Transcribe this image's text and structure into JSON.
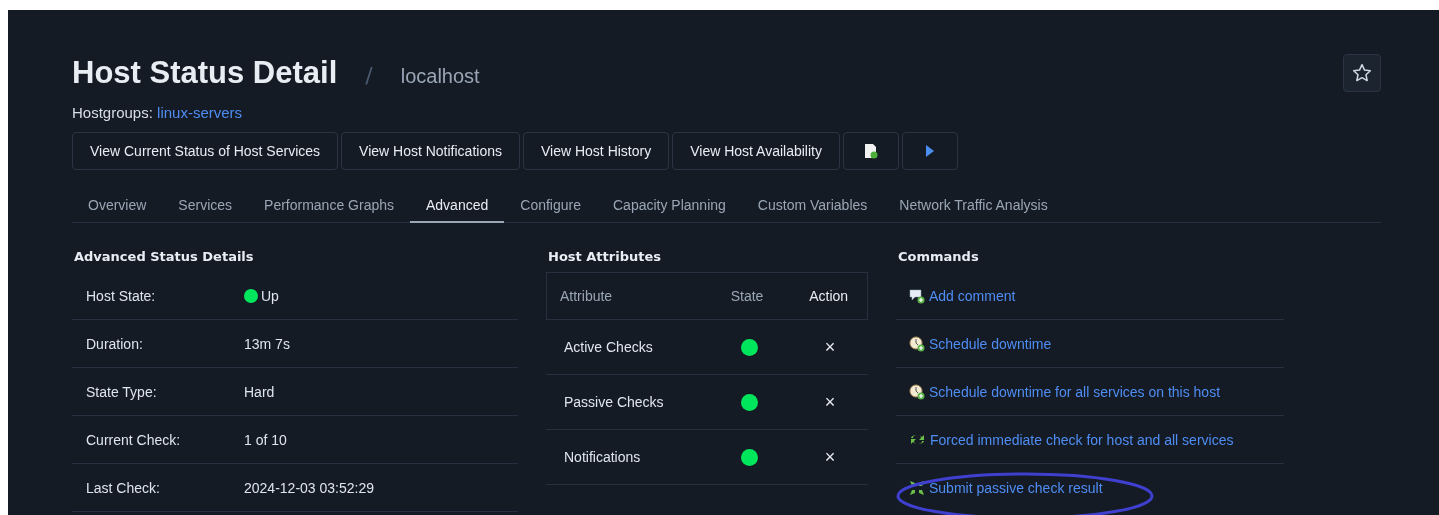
{
  "header": {
    "title": "Host Status Detail",
    "separator": "/",
    "host": "localhost",
    "hostgroups_label": "Hostgroups:",
    "hostgroup": "linux-servers"
  },
  "actions": [
    {
      "kind": "text",
      "label": "View Current Status of Host Services"
    },
    {
      "kind": "text",
      "label": "View Host Notifications"
    },
    {
      "kind": "text",
      "label": "View Host History"
    },
    {
      "kind": "text",
      "label": "View Host Availability"
    },
    {
      "kind": "document"
    },
    {
      "kind": "play"
    }
  ],
  "tabs": [
    {
      "label": "Overview",
      "selected": false
    },
    {
      "label": "Services",
      "selected": false
    },
    {
      "label": "Performance Graphs",
      "selected": false
    },
    {
      "label": "Advanced",
      "selected": true
    },
    {
      "label": "Configure",
      "selected": false
    },
    {
      "label": "Capacity Planning",
      "selected": false
    },
    {
      "label": "Custom Variables",
      "selected": false
    },
    {
      "label": "Network Traffic Analysis",
      "selected": false
    }
  ],
  "status_details": {
    "title": "Advanced Status Details",
    "rows": [
      {
        "label": "Host State:",
        "value": "Up",
        "kind": "status",
        "color": "#00e65c"
      },
      {
        "label": "Duration:",
        "value": "13m 7s",
        "kind": "text"
      },
      {
        "label": "State Type:",
        "value": "Hard",
        "kind": "text"
      },
      {
        "label": "Current Check:",
        "value": "1 of 10",
        "kind": "text"
      },
      {
        "label": "Last Check:",
        "value": "2024-12-03 03:52:29",
        "kind": "text"
      }
    ]
  },
  "host_attributes": {
    "title": "Host Attributes",
    "columns": [
      "Attribute",
      "State",
      "Action"
    ],
    "rows": [
      {
        "name": "Active Checks",
        "enabled": true,
        "action": "×"
      },
      {
        "name": "Passive Checks",
        "enabled": true,
        "action": "×"
      },
      {
        "name": "Notifications",
        "enabled": true,
        "action": "×"
      }
    ]
  },
  "commands": {
    "title": "Commands",
    "items": [
      {
        "label": "Add comment",
        "kind": "comment",
        "highlighted": false
      },
      {
        "label": "Schedule downtime",
        "kind": "downtime",
        "highlighted": false
      },
      {
        "label": "Schedule downtime for all services on this host",
        "kind": "downtime",
        "highlighted": false
      },
      {
        "label": "Forced immediate check for host and all services",
        "kind": "recheck",
        "highlighted": false
      },
      {
        "label": "Submit passive check result",
        "kind": "passive",
        "highlighted": true
      }
    ]
  }
}
